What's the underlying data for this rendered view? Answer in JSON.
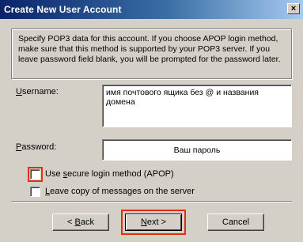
{
  "window": {
    "title": "Create New User Account",
    "close_label": "×"
  },
  "info": {
    "text": "Specify POP3 data for this account. If you choose APOP login method, make sure that this method is supported by your POP3 server. If you leave password field blank, you will be prompted for the password later."
  },
  "username": {
    "label_accel": "U",
    "label_rest": "sername:",
    "value": "имя почтового ящика без @ и названия домена"
  },
  "password": {
    "label_accel": "P",
    "label_rest": "assword:",
    "value": "Ваш пароль"
  },
  "options": {
    "apop": {
      "pre": "Use ",
      "accel": "s",
      "post": "ecure login method (APOP)",
      "checked": false
    },
    "leave_copy": {
      "accel": "L",
      "post": "eave copy of messages on the server",
      "checked": false
    }
  },
  "buttons": {
    "back_pre": "< ",
    "back_accel": "B",
    "back_post": "ack",
    "next_accel": "N",
    "next_post": "ext >",
    "cancel": "Cancel"
  },
  "colors": {
    "title_start": "#0a246a",
    "title_end": "#a6caf0",
    "highlight": "#e03010",
    "face": "#d4d0c8"
  }
}
